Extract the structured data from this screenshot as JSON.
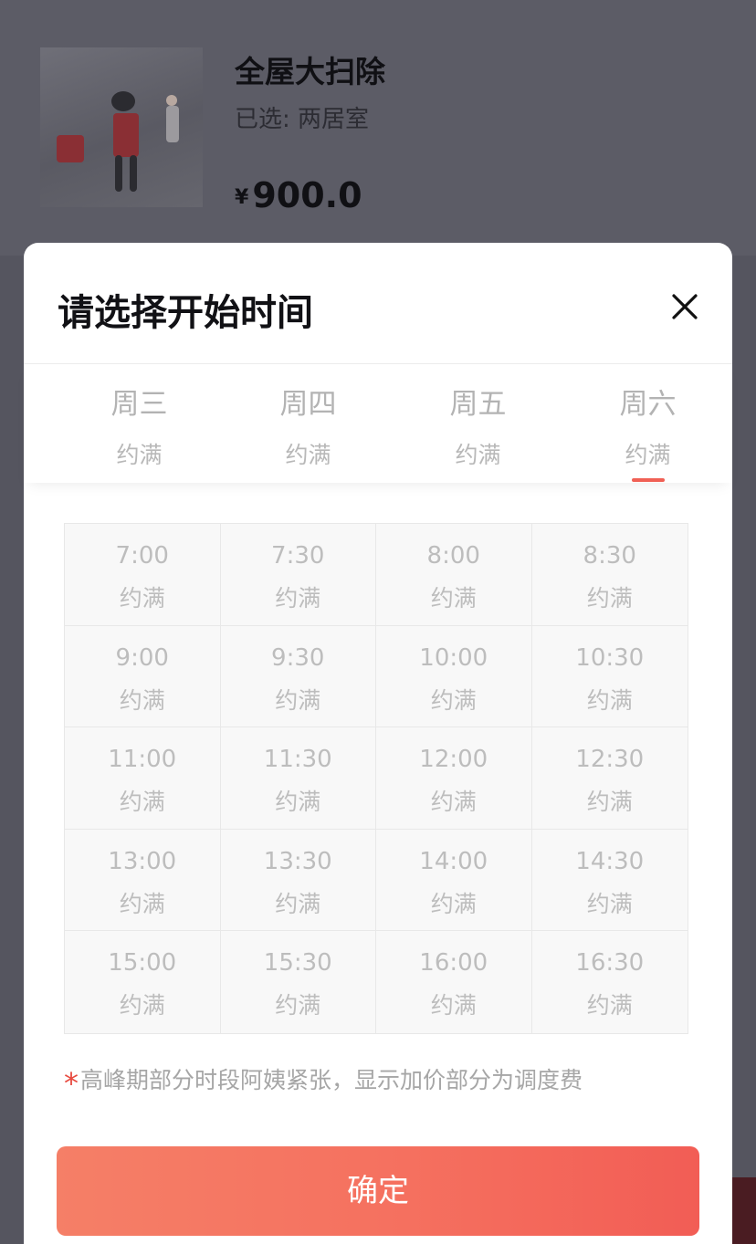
{
  "product": {
    "title": "全屋大扫除",
    "selected": "已选: 两居室",
    "currency": "¥",
    "price": "900.0"
  },
  "modal": {
    "title": "请选择开始时间",
    "close_icon": "close-icon"
  },
  "days": [
    {
      "name": "周三",
      "status": "约满"
    },
    {
      "name": "周四",
      "status": "约满"
    },
    {
      "name": "周五",
      "status": "约满"
    },
    {
      "name": "周六",
      "status": "约满"
    }
  ],
  "active_day": "周六",
  "slots": [
    {
      "time": "7:00",
      "status": "约满"
    },
    {
      "time": "7:30",
      "status": "约满"
    },
    {
      "time": "8:00",
      "status": "约满"
    },
    {
      "time": "8:30",
      "status": "约满"
    },
    {
      "time": "9:00",
      "status": "约满"
    },
    {
      "time": "9:30",
      "status": "约满"
    },
    {
      "time": "10:00",
      "status": "约满"
    },
    {
      "time": "10:30",
      "status": "约满"
    },
    {
      "time": "11:00",
      "status": "约满"
    },
    {
      "time": "11:30",
      "status": "约满"
    },
    {
      "time": "12:00",
      "status": "约满"
    },
    {
      "time": "12:30",
      "status": "约满"
    },
    {
      "time": "13:00",
      "status": "约满"
    },
    {
      "time": "13:30",
      "status": "约满"
    },
    {
      "time": "14:00",
      "status": "约满"
    },
    {
      "time": "14:30",
      "status": "约满"
    },
    {
      "time": "15:00",
      "status": "约满"
    },
    {
      "time": "15:30",
      "status": "约满"
    },
    {
      "time": "16:00",
      "status": "约满"
    },
    {
      "time": "16:30",
      "status": "约满"
    }
  ],
  "note": {
    "star": "*",
    "text": "高峰期部分时段阿姨紧张，显示加价部分为调度费"
  },
  "confirm_label": "确定",
  "colors": {
    "accent": "#f06055",
    "button_start": "#f57f67",
    "button_end": "#f25d55",
    "disabled_text": "#bdbdbd"
  }
}
